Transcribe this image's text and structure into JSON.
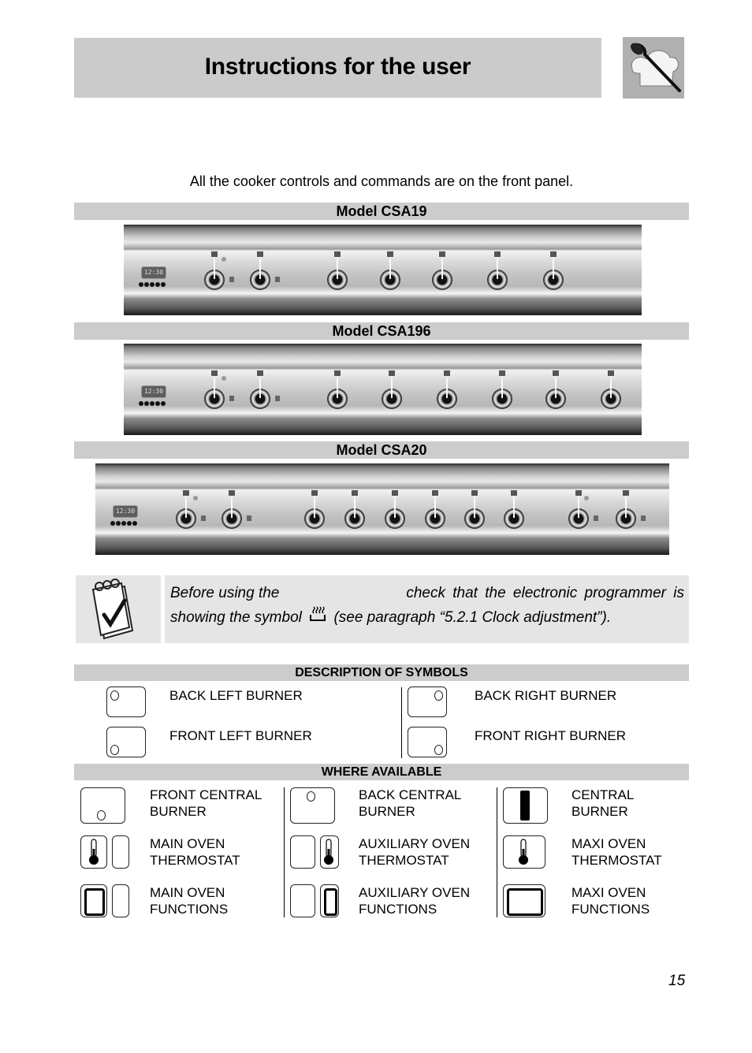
{
  "header": {
    "title": "Instructions for the user",
    "logo_icon": "chef-hat-spoon-icon"
  },
  "intro": "All the cooker controls and commands are on the front panel.",
  "models": [
    {
      "label": "Model CSA19",
      "clock": "12:30",
      "knob_count": 7
    },
    {
      "label": "Model CSA196",
      "clock": "12:30",
      "knob_count": 8
    },
    {
      "label": "Model CSA20",
      "clock": "12:30",
      "knob_count": 10
    }
  ],
  "note": {
    "icon": "notepad-check-icon",
    "line1_a": "Before using the",
    "line1_b": "check that the electronic programmer is",
    "line2_a": "showing the symbol",
    "symbol_icon": "pan-heat-icon",
    "line2_b": "(see paragraph “5.2.1 Clock adjustment”)."
  },
  "symbols": {
    "title": "DESCRIPTION OF SYMBOLS",
    "items": [
      {
        "label": "BACK LEFT BURNER",
        "icon": "back-left-burner-icon"
      },
      {
        "label": "BACK RIGHT BURNER",
        "icon": "back-right-burner-icon"
      },
      {
        "label": "FRONT LEFT BURNER",
        "icon": "front-left-burner-icon"
      },
      {
        "label": "FRONT RIGHT BURNER",
        "icon": "front-right-burner-icon"
      }
    ]
  },
  "where_available": {
    "title": "WHERE AVAILABLE",
    "items": [
      {
        "line1": "FRONT CENTRAL",
        "line2": "BURNER"
      },
      {
        "line1": "BACK CENTRAL",
        "line2": "BURNER"
      },
      {
        "line1": "CENTRAL",
        "line2": "BURNER"
      },
      {
        "line1": "MAIN OVEN",
        "line2": "THERMOSTAT"
      },
      {
        "line1": "AUXILIARY OVEN",
        "line2": "THERMOSTAT"
      },
      {
        "line1": "MAXI OVEN",
        "line2": "THERMOSTAT"
      },
      {
        "line1": "MAIN OVEN",
        "line2": "FUNCTIONS"
      },
      {
        "line1": "AUXILIARY OVEN",
        "line2": "FUNCTIONS"
      },
      {
        "line1": "MAXI OVEN",
        "line2": "FUNCTIONS"
      }
    ]
  },
  "page_number": "15"
}
